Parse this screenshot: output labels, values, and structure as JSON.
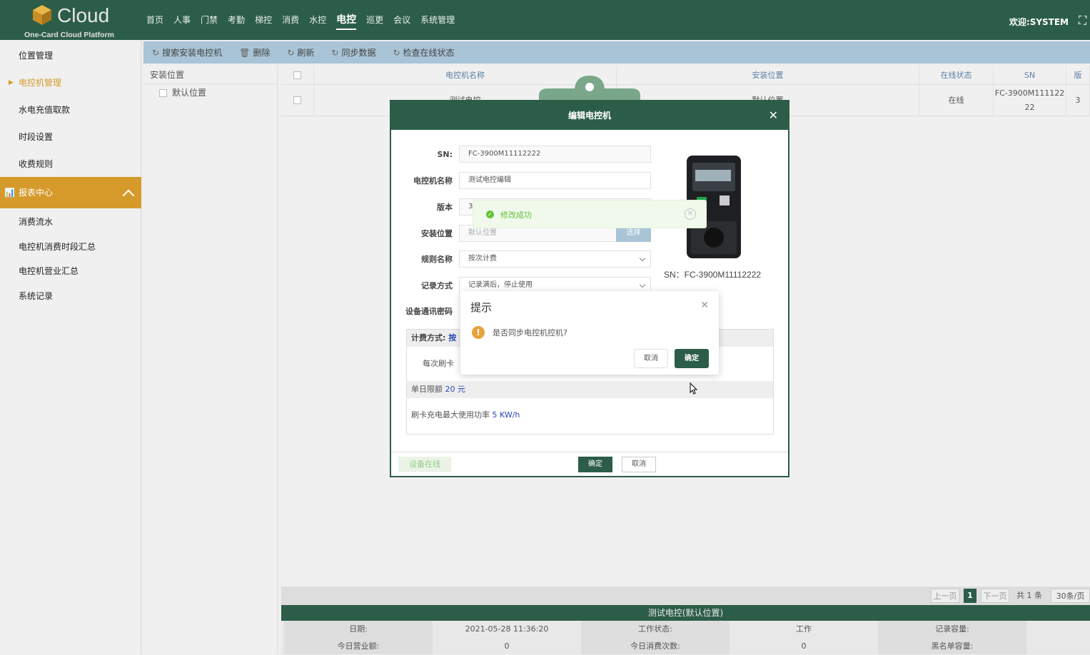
{
  "header": {
    "logo_name": "Cloud",
    "logo_sub": "One-Card Cloud Platform",
    "nav": [
      "首页",
      "人事",
      "门禁",
      "考勤",
      "梯控",
      "消费",
      "水控",
      "电控",
      "巡更",
      "会议",
      "系统管理"
    ],
    "active_nav": "电控",
    "welcome": "欢迎:SYSTEM"
  },
  "sidebar": {
    "items": [
      "位置管理",
      "电控机管理",
      "水电充值取款",
      "时段设置",
      "收费规则"
    ],
    "section": "报表中心",
    "report_items": [
      "消费流水",
      "电控机消费时段汇总",
      "电控机营业汇总",
      "系统记录"
    ]
  },
  "toolbar": {
    "search": "搜索安装电控机",
    "delete": "删除",
    "refresh": "刷新",
    "sync": "同步数据",
    "check": "检查在线状态"
  },
  "tree": {
    "header": "安装位置",
    "node": "默认位置"
  },
  "grid": {
    "columns": [
      "电控机名称",
      "安装位置",
      "在线状态",
      "SN",
      "版"
    ],
    "row": {
      "name": "测试电控",
      "location": "默认位置",
      "status": "在线",
      "sn_1": "FC-3900M111122",
      "sn_2": "22",
      "extra": "3"
    }
  },
  "pager": {
    "prev": "上一页",
    "page": "1",
    "next": "下一页",
    "total": "共 1 条",
    "size": "30条/页"
  },
  "detail": {
    "title": "测试电控(默认位置)",
    "row1": [
      "日期:",
      "2021-05-28 11:36:20",
      "工作状态:",
      "工作",
      "记录容量:"
    ],
    "row2": [
      "今日营业额:",
      "0",
      "今日消费次数:",
      "0",
      "黑名单容量:"
    ]
  },
  "dialog": {
    "title": "编辑电控机",
    "sn_label": "SN:",
    "sn_value": "FC-3900M11112222",
    "name_label": "电控机名称",
    "name_value": "测试电控编辑",
    "version_label": "版本",
    "version_value": "3",
    "location_label": "安装位置",
    "location_value": "默认位置",
    "select_btn": "选择",
    "rule_label": "规则名称",
    "rule_value": "按次计费",
    "record_label": "记录方式",
    "record_value": "记录满后，停止使用",
    "pwd_label": "设备通讯密码",
    "device_sn": "SN：FC-3900M11112222",
    "fee_mode": "计费方式:",
    "fee_mode_val": "按",
    "per_swipe": "每次刷卡",
    "daily_limit_label": "单日限额",
    "daily_limit_val": "20 元",
    "max_power_label": "刷卡充电最大使用功率",
    "max_power_val": "5 KW/h",
    "online": "设备在线",
    "ok": "确定",
    "cancel": "取消"
  },
  "toast": {
    "message": "修改成功"
  },
  "confirm": {
    "title": "提示",
    "question": "是否同步电控机控机?",
    "cancel": "取消",
    "ok": "确定"
  }
}
